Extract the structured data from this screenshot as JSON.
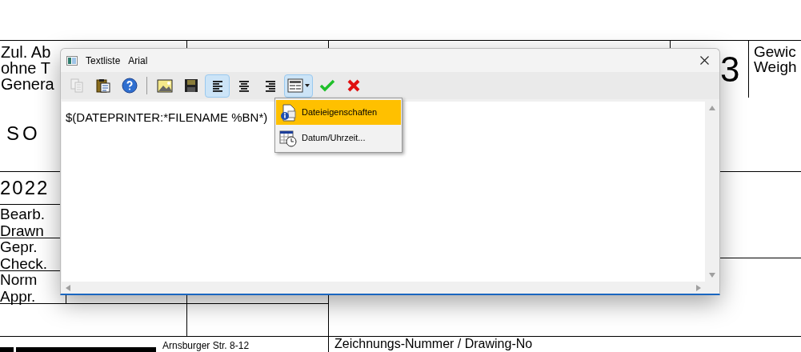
{
  "title_block": {
    "top_left": [
      "Zul. Ab",
      "ohne T",
      "Genera"
    ],
    "iso": "SO",
    "year": "2022",
    "roles": [
      "Bearb.",
      "Drawn",
      "Gepr.",
      "Check.",
      "Norm",
      "Appr."
    ],
    "sheet_digit": "3",
    "weight_label": [
      "Gewic",
      "Weigh"
    ],
    "address": "Arnsburger Str. 8-12",
    "drawing_no_label": "Zeichnungs-Nummer / Drawing-No"
  },
  "dialog": {
    "title": "Textliste",
    "font": "Arial",
    "toolbar": [
      {
        "kind": "copy",
        "disabled": true
      },
      {
        "kind": "paste",
        "disabled": false
      },
      {
        "kind": "help",
        "disabled": false
      },
      {
        "kind": "separator"
      },
      {
        "kind": "image",
        "disabled": false
      },
      {
        "kind": "save",
        "disabled": false
      },
      {
        "kind": "align-left",
        "selected": true
      },
      {
        "kind": "align-center",
        "selected": false
      },
      {
        "kind": "align-right",
        "selected": false
      },
      {
        "kind": "insert-field",
        "open": true
      },
      {
        "kind": "ok",
        "disabled": false
      },
      {
        "kind": "cancel",
        "disabled": false
      }
    ],
    "text": "$(DATEPRINTER:*FILENAME %BN*)",
    "menu": [
      {
        "kind": "file-properties",
        "label": "Dateieigenschaften",
        "selected": true
      },
      {
        "kind": "date-time",
        "label": "Datum/Uhrzeit...",
        "selected": false
      }
    ]
  }
}
